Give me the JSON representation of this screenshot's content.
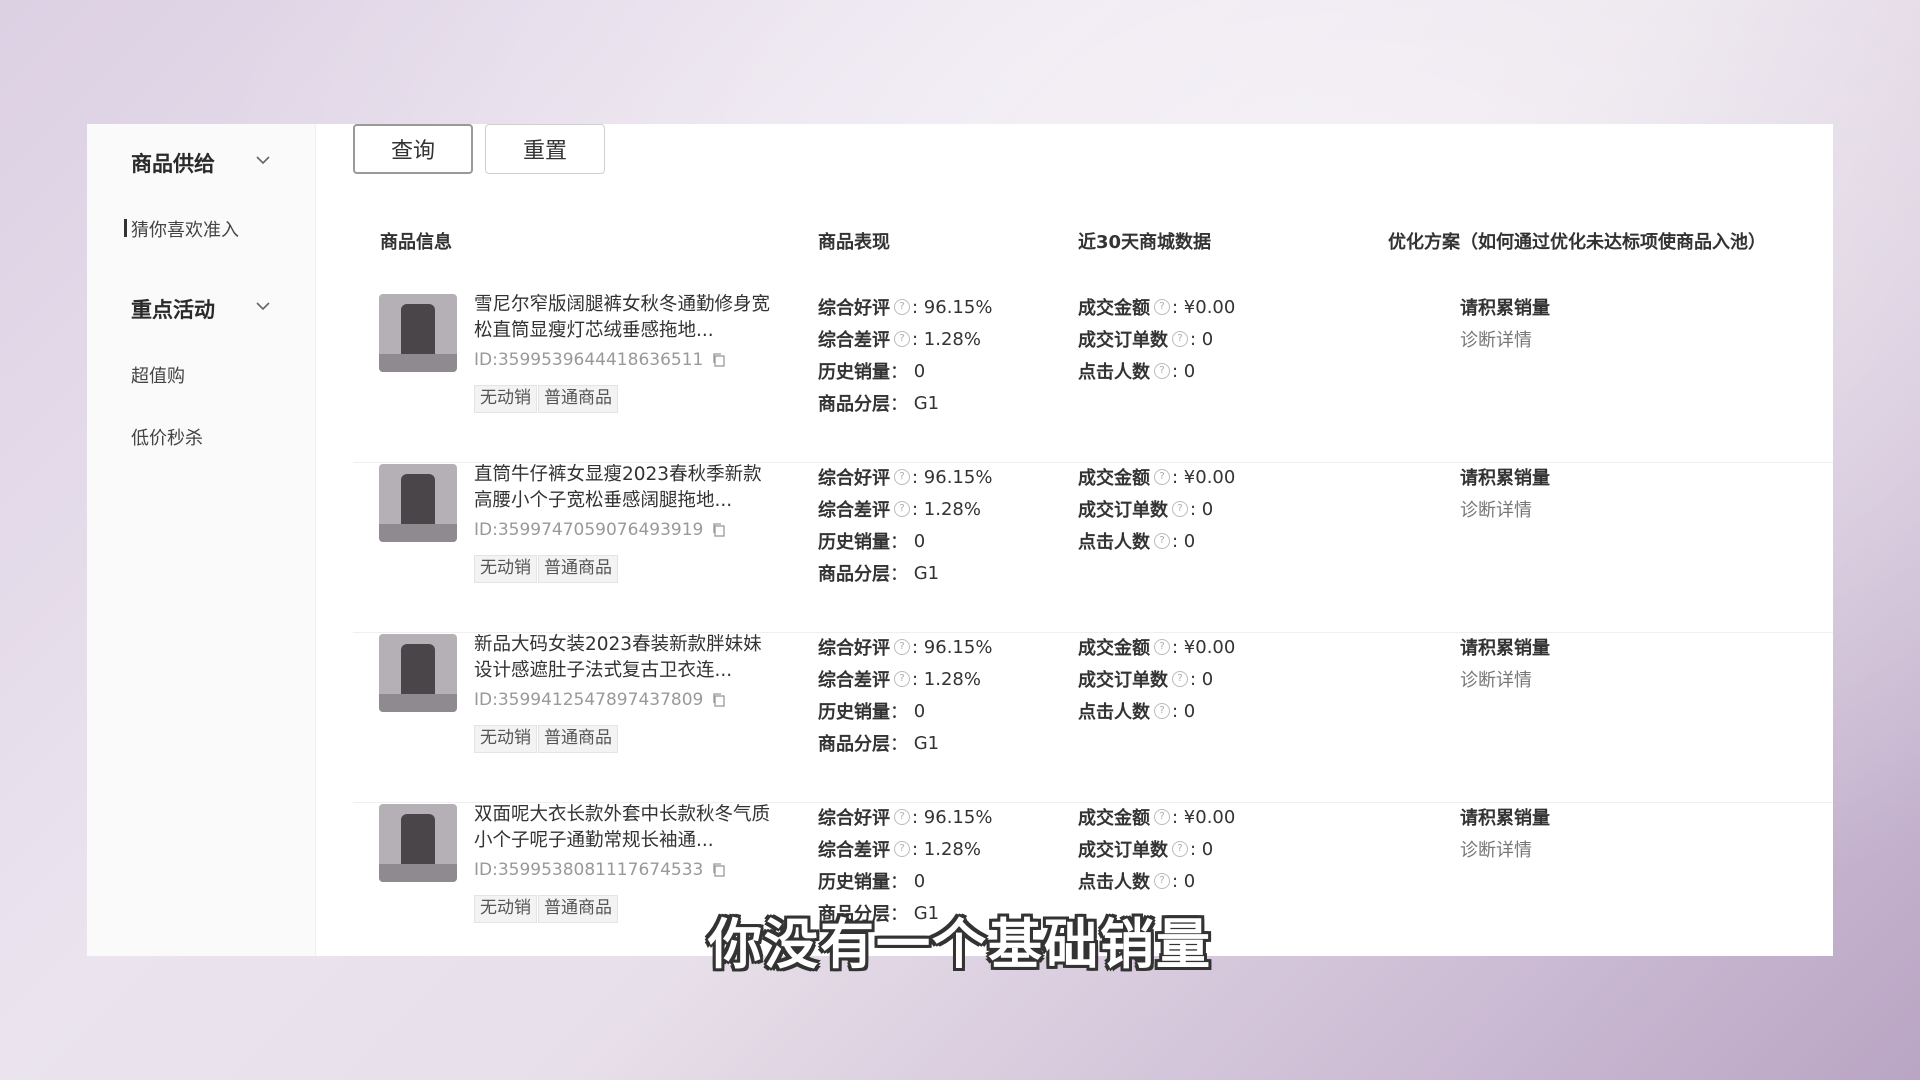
{
  "sidebar": {
    "groups": [
      {
        "label": "商品供给",
        "items": [
          {
            "label": "猜你喜欢准入"
          }
        ]
      },
      {
        "label": "重点活动",
        "items": [
          {
            "label": "超值购"
          },
          {
            "label": "低价秒杀"
          }
        ]
      }
    ]
  },
  "toolbar": {
    "query_label": "查询",
    "reset_label": "重置"
  },
  "table": {
    "headers": [
      "商品信息",
      "商品表现",
      "近30天商城数据",
      "优化方案（如何通过优化未达标项使商品入池）"
    ],
    "metric_labels": {
      "good_rate": "综合好评",
      "bad_rate": "综合差评",
      "history_sales": "历史销量",
      "tier": "商品分层",
      "gmv": "成交金额",
      "orders": "成交订单数",
      "clicks": "点击人数"
    },
    "rows": [
      {
        "title": "雪尼尔窄版阔腿裤女秋冬通勤修身宽松直筒显瘦灯芯绒垂感拖地...",
        "id": "ID:3599539644418636511",
        "tags": [
          "无动销",
          "普通商品"
        ],
        "good_rate": "96.15%",
        "bad_rate": "1.28%",
        "history_sales": "0",
        "tier": "G1",
        "gmv": "¥0.00",
        "orders": "0",
        "clicks": "0",
        "plan": "请积累销量",
        "plan_link": "诊断详情"
      },
      {
        "title": "直筒牛仔裤女显瘦2023春秋季新款高腰小个子宽松垂感阔腿拖地...",
        "id": "ID:3599747059076493919",
        "tags": [
          "无动销",
          "普通商品"
        ],
        "good_rate": "96.15%",
        "bad_rate": "1.28%",
        "history_sales": "0",
        "tier": "G1",
        "gmv": "¥0.00",
        "orders": "0",
        "clicks": "0",
        "plan": "请积累销量",
        "plan_link": "诊断详情"
      },
      {
        "title": "新品大码女装2023春装新款胖妹妹设计感遮肚子法式复古卫衣连...",
        "id": "ID:3599412547897437809",
        "tags": [
          "无动销",
          "普通商品"
        ],
        "good_rate": "96.15%",
        "bad_rate": "1.28%",
        "history_sales": "0",
        "tier": "G1",
        "gmv": "¥0.00",
        "orders": "0",
        "clicks": "0",
        "plan": "请积累销量",
        "plan_link": "诊断详情"
      },
      {
        "title": "双面呢大衣长款外套中长款秋冬气质小个子呢子通勤常规长袖通...",
        "id": "ID:3599538081117674533",
        "tags": [
          "无动销",
          "普通商品"
        ],
        "good_rate": "96.15%",
        "bad_rate": "1.28%",
        "history_sales": "0",
        "tier": "G1",
        "gmv": "¥0.00",
        "orders": "0",
        "clicks": "0",
        "plan": "请积累销量",
        "plan_link": "诊断详情"
      }
    ]
  },
  "subtitle": "你没有一个基础销量",
  "colors": {
    "panel": "#ffffff",
    "sidebar": "#fafafa",
    "background": "#d9cce1"
  }
}
